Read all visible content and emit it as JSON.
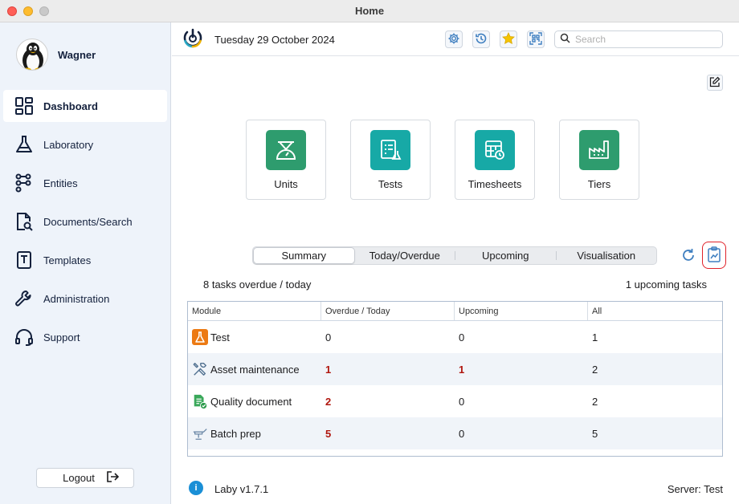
{
  "window": {
    "title": "Home"
  },
  "user": {
    "name": "Wagner"
  },
  "sidebar": {
    "items": [
      {
        "label": "Dashboard",
        "icon": "dashboard-icon",
        "active": true
      },
      {
        "label": "Laboratory",
        "icon": "flask-icon"
      },
      {
        "label": "Entities",
        "icon": "entities-icon"
      },
      {
        "label": "Documents/Search",
        "icon": "document-search-icon"
      },
      {
        "label": "Templates",
        "icon": "template-icon"
      },
      {
        "label": "Administration",
        "icon": "wrench-icon"
      },
      {
        "label": "Support",
        "icon": "headset-icon"
      }
    ],
    "logout_label": "Logout"
  },
  "topbar": {
    "date": "Tuesday 29 October 2024",
    "search_placeholder": "Search",
    "search_value": ""
  },
  "tiles": [
    {
      "label": "Units",
      "color": "#2e9c6e"
    },
    {
      "label": "Tests",
      "color": "#17a9a6"
    },
    {
      "label": "Timesheets",
      "color": "#17a9a6"
    },
    {
      "label": "Tiers",
      "color": "#2e9c6e"
    }
  ],
  "tabs": [
    "Summary",
    "Today/Overdue",
    "Upcoming",
    "Visualisation"
  ],
  "summary": {
    "overdue_text": "8 tasks overdue / today",
    "upcoming_text": "1 upcoming tasks"
  },
  "table": {
    "headers": [
      "Module",
      "Overdue / Today",
      "Upcoming",
      "All"
    ],
    "rows": [
      {
        "module": "Test",
        "icon": "flask-icon",
        "overdue": "0",
        "upcoming": "0",
        "all": "1",
        "overdue_alert": false,
        "upcoming_alert": false
      },
      {
        "module": "Asset maintenance",
        "icon": "tools-icon",
        "overdue": "1",
        "upcoming": "1",
        "all": "2",
        "overdue_alert": true,
        "upcoming_alert": true
      },
      {
        "module": "Quality document",
        "icon": "quality-document-icon",
        "overdue": "2",
        "upcoming": "0",
        "all": "2",
        "overdue_alert": true,
        "upcoming_alert": false
      },
      {
        "module": "Batch prep",
        "icon": "batch-prep-icon",
        "overdue": "5",
        "upcoming": "0",
        "all": "5",
        "overdue_alert": true,
        "upcoming_alert": false
      }
    ]
  },
  "footer": {
    "version": "Laby v1.7.1",
    "server": "Server: Test"
  },
  "colors": {
    "accent": "#14213d",
    "alert": "#b0160e",
    "highlight_border": "#e0222a"
  }
}
